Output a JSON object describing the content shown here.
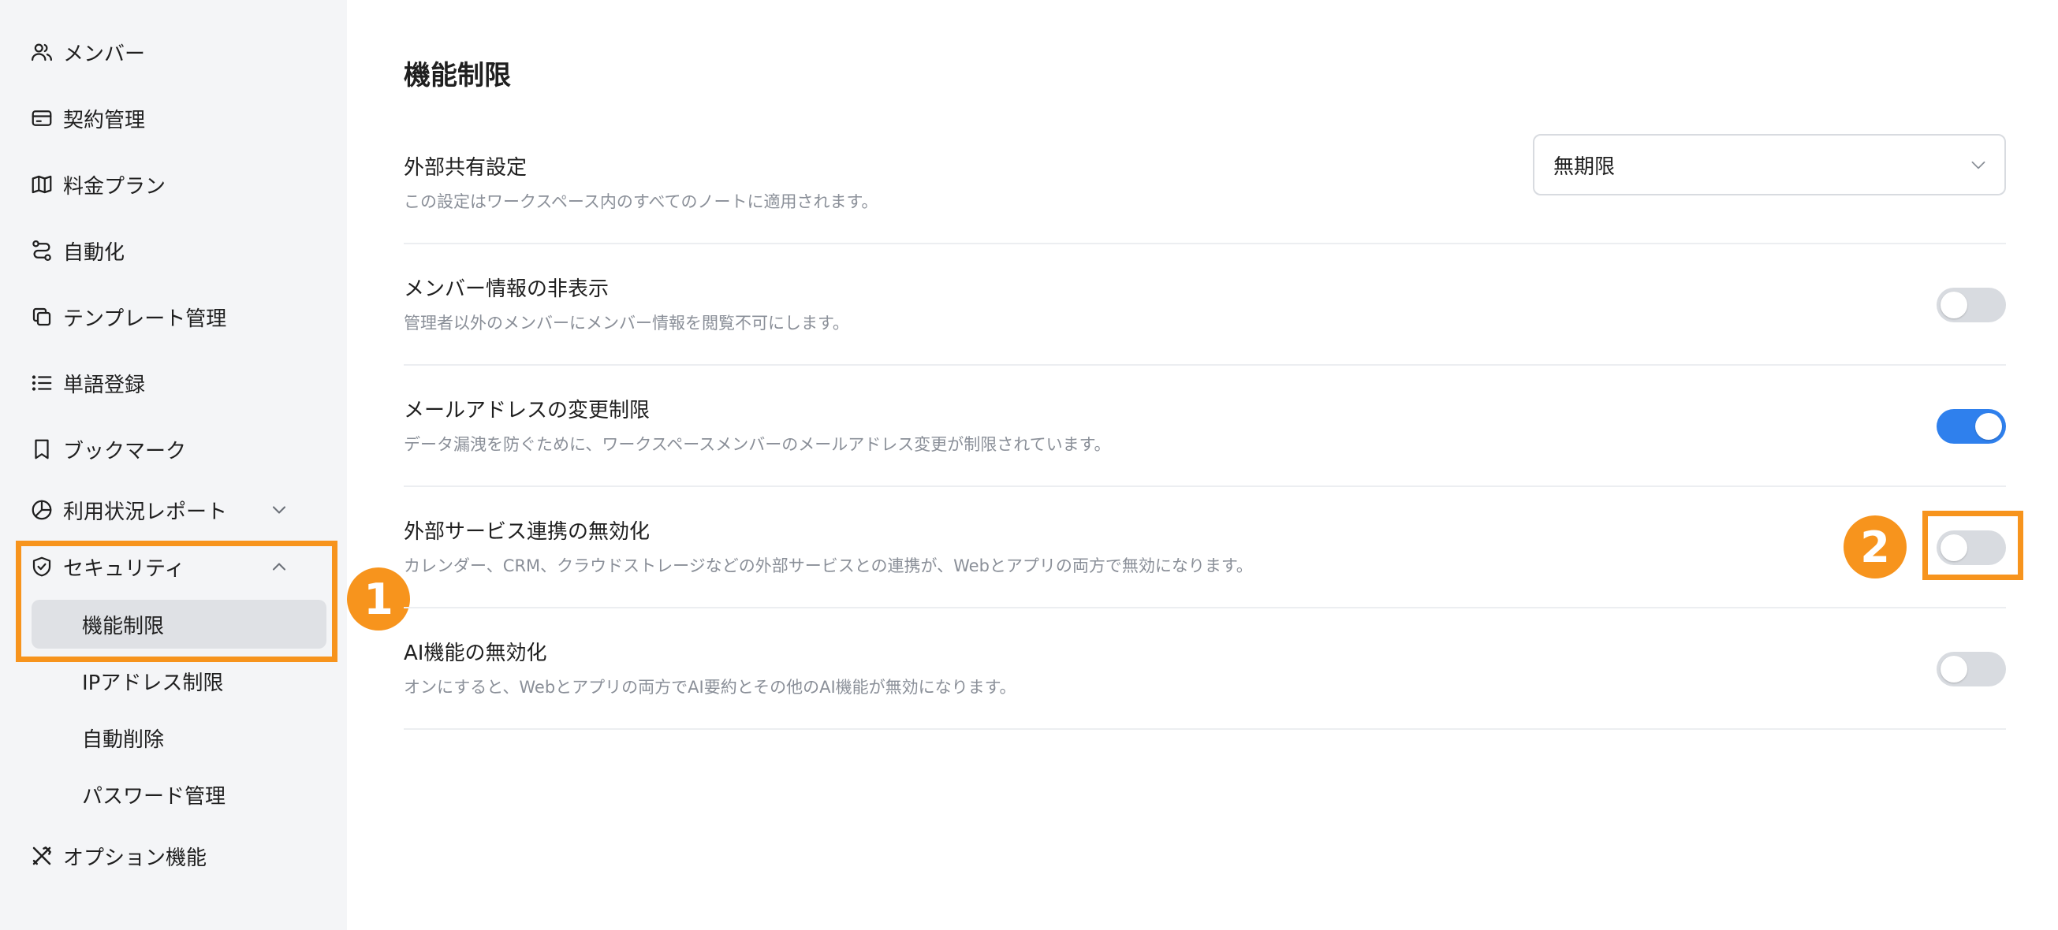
{
  "sidebar": {
    "items": [
      {
        "label": "メンバー",
        "icon": "users-icon"
      },
      {
        "label": "契約管理",
        "icon": "credit-card-icon"
      },
      {
        "label": "料金プラン",
        "icon": "map-icon"
      },
      {
        "label": "自動化",
        "icon": "route-icon"
      },
      {
        "label": "テンプレート管理",
        "icon": "copy-icon"
      },
      {
        "label": "単語登録",
        "icon": "list-icon"
      },
      {
        "label": "ブックマーク",
        "icon": "bookmark-icon"
      },
      {
        "label": "利用状況レポート",
        "icon": "pie-chart-icon"
      },
      {
        "label": "セキュリティ",
        "icon": "shield-check-icon"
      },
      {
        "label": "オプション機能",
        "icon": "tools-icon"
      }
    ],
    "security_sub": [
      {
        "label": "機能制限",
        "active": true
      },
      {
        "label": "IPアドレス制限",
        "active": false
      },
      {
        "label": "自動削除",
        "active": false
      },
      {
        "label": "パスワード管理",
        "active": false
      }
    ]
  },
  "annotations": {
    "badge1": "1",
    "badge2": "2",
    "highlight_color": "#f7941d"
  },
  "main": {
    "title": "機能制限",
    "settings": [
      {
        "title": "外部共有設定",
        "description": "この設定はワークスペース内のすべてのノートに適用されます。",
        "control": "select",
        "value": "無期限"
      },
      {
        "title": "メンバー情報の非表示",
        "description": "管理者以外のメンバーにメンバー情報を閲覧不可にします。",
        "control": "toggle",
        "on": false
      },
      {
        "title": "メールアドレスの変更制限",
        "description": "データ漏洩を防ぐために、ワークスペースメンバーのメールアドレス変更が制限されています。",
        "control": "toggle",
        "on": true
      },
      {
        "title": "外部サービス連携の無効化",
        "description": "カレンダー、CRM、クラウドストレージなどの外部サービスとの連携が、Webとアプリの両方で無効になります。",
        "control": "toggle",
        "on": false
      },
      {
        "title": "AI機能の無効化",
        "description": "オンにすると、Webとアプリの両方でAI要約とその他のAI機能が無効になります。",
        "control": "toggle",
        "on": false
      }
    ]
  },
  "colors": {
    "toggle_on": "#2f80ed",
    "toggle_off": "#d8dbe0",
    "sidebar_bg": "#f4f5f7"
  }
}
